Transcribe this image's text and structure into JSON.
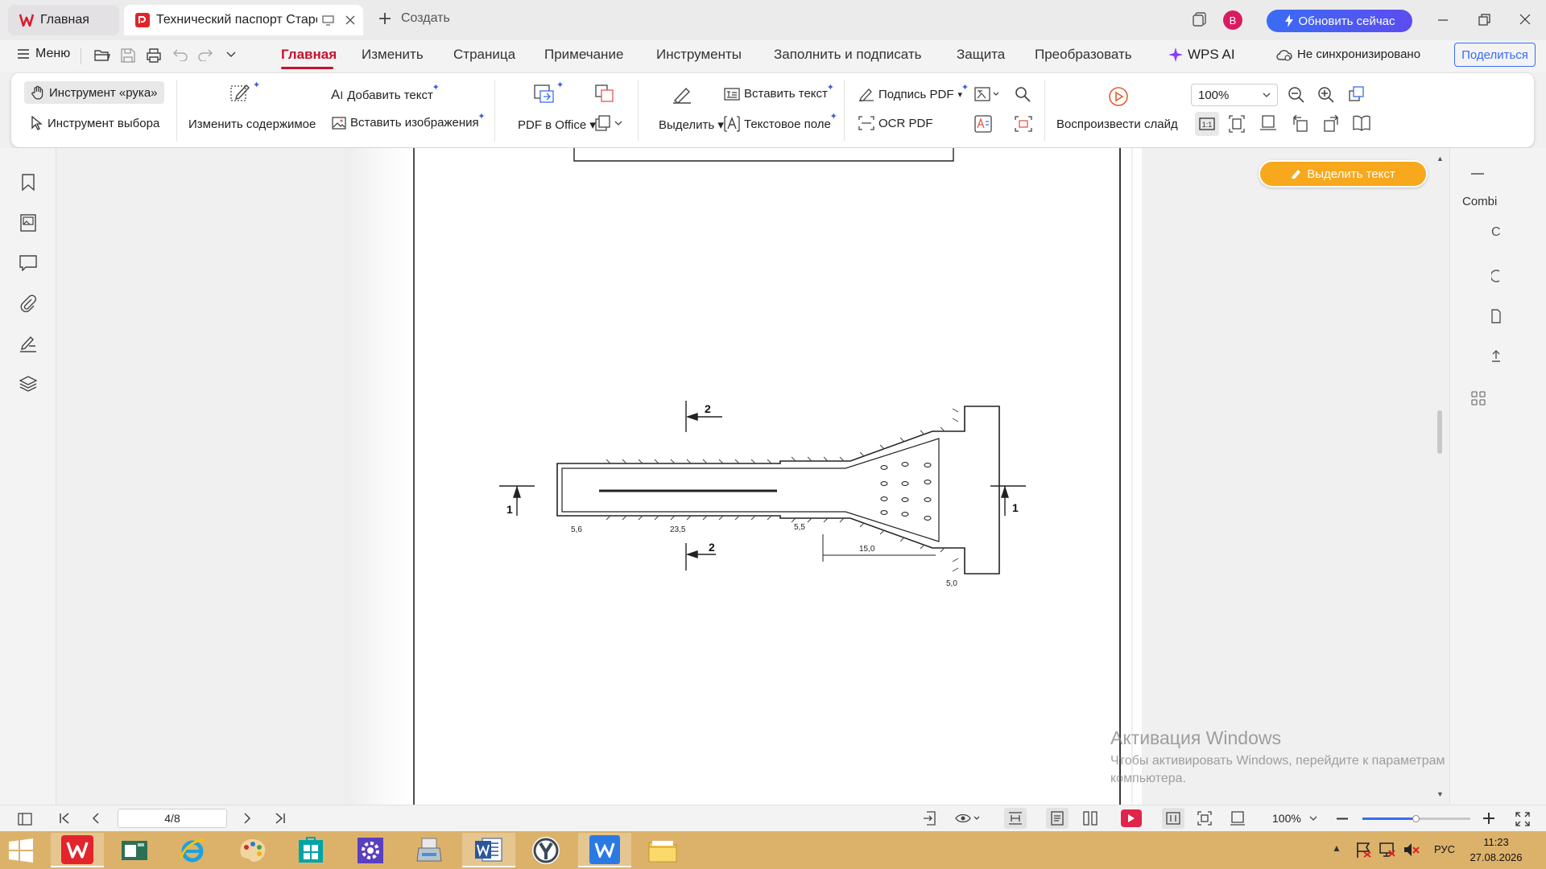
{
  "titlebar": {
    "tab_home_label": "Главная",
    "tab_doc_label": "Технический паспорт Старо",
    "new_tab_label": "Создать",
    "avatar_letter": "В",
    "update_button": "Обновить сейчас"
  },
  "menubar": {
    "menu_label": "Меню",
    "tabs": [
      "Главная",
      "Изменить",
      "Страница",
      "Примечание",
      "Инструменты",
      "Заполнить и подписать",
      "Защита",
      "Преобразовать"
    ],
    "wps_ai": "WPS AI",
    "sync_status": "Не синхронизировано",
    "share_button": "Поделиться"
  },
  "ribbon": {
    "hand_tool": "Инструмент «рука»",
    "select_tool": "Инструмент выбора",
    "edit_content": "Изменить содержимое",
    "add_text": "Добавить текст",
    "insert_image": "Вставить изображения",
    "pdf_to_office": "PDF в Office",
    "highlight": "Выделить",
    "insert_text": "Вставить текст",
    "text_field": "Текстовое поле",
    "sign_pdf": "Подпись PDF",
    "ocr_pdf": "OCR PDF",
    "play_slide": "Воспроизвести слайд",
    "zoom_value": "100%"
  },
  "highlight_text_button": "Выделить текст",
  "right_panel_label": "Combi",
  "drawing": {
    "section_top": "2",
    "section_bottom": "2",
    "section_left": "1",
    "section_right": "1",
    "dim_1": "5,6",
    "dim_2": "23,5",
    "dim_3": "5,5",
    "dim_4": "15,0",
    "dim_5": "5,0"
  },
  "watermark": {
    "title": "Активация Windows",
    "line1": "Чтобы активировать Windows, перейдите к параметрам",
    "line2": "компьютера."
  },
  "statusbar": {
    "page_indicator": "4/8",
    "zoom": "100%"
  },
  "taskbar": {
    "lang": "РУС",
    "time": "11:23",
    "date": "27.08.2026"
  }
}
